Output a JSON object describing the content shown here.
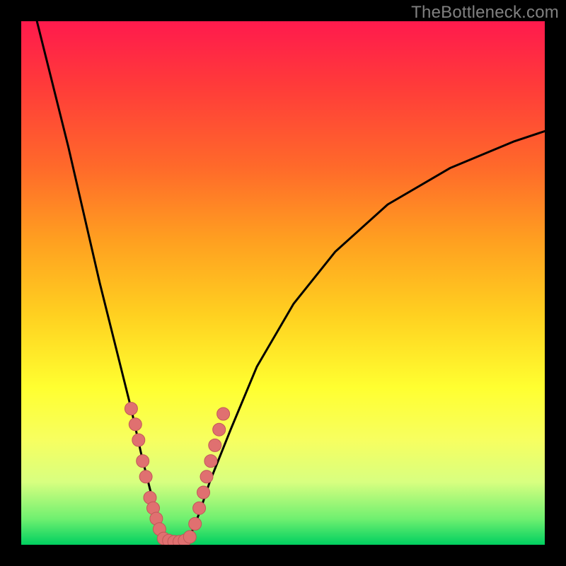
{
  "watermark": "TheBottleneck.com",
  "colors": {
    "frame": "#000000",
    "curve": "#000000",
    "marker_fill": "#e07070",
    "marker_stroke": "#c05858",
    "gradient_top": "#ff1a4d",
    "gradient_bottom": "#00d060"
  },
  "chart_data": {
    "type": "line",
    "title": "",
    "xlabel": "",
    "ylabel": "",
    "xlim": [
      0,
      100
    ],
    "ylim": [
      0,
      100
    ],
    "note": "Axes unlabeled; values are read as percentages of the plotting area width (x) and height from bottom (y). Bottleneck-style V-curve with minimum near x≈27.",
    "series": [
      {
        "name": "left-branch",
        "x": [
          3,
          6,
          9,
          12,
          15,
          18,
          21,
          23,
          25,
          26,
          27
        ],
        "y": [
          100,
          88,
          76,
          63,
          50,
          38,
          26,
          17,
          9,
          4,
          1
        ]
      },
      {
        "name": "valley",
        "x": [
          27,
          28,
          30,
          32
        ],
        "y": [
          1,
          0.5,
          0.5,
          1
        ]
      },
      {
        "name": "right-branch",
        "x": [
          32,
          34,
          36,
          40,
          45,
          52,
          60,
          70,
          82,
          94,
          100
        ],
        "y": [
          1,
          6,
          12,
          22,
          34,
          46,
          56,
          65,
          72,
          77,
          79
        ]
      }
    ],
    "markers": {
      "name": "highlighted-points",
      "note": "Salmon dots clustered on both sides of the valley and along its floor.",
      "points": [
        {
          "x": 21.0,
          "y": 26
        },
        {
          "x": 21.8,
          "y": 23
        },
        {
          "x": 22.4,
          "y": 20
        },
        {
          "x": 23.2,
          "y": 16
        },
        {
          "x": 23.8,
          "y": 13
        },
        {
          "x": 24.6,
          "y": 9
        },
        {
          "x": 25.2,
          "y": 7
        },
        {
          "x": 25.8,
          "y": 5
        },
        {
          "x": 26.4,
          "y": 3
        },
        {
          "x": 27.2,
          "y": 1.2
        },
        {
          "x": 28.2,
          "y": 0.8
        },
        {
          "x": 29.2,
          "y": 0.6
        },
        {
          "x": 30.2,
          "y": 0.6
        },
        {
          "x": 31.2,
          "y": 0.8
        },
        {
          "x": 32.2,
          "y": 1.5
        },
        {
          "x": 33.2,
          "y": 4
        },
        {
          "x": 34.0,
          "y": 7
        },
        {
          "x": 34.8,
          "y": 10
        },
        {
          "x": 35.4,
          "y": 13
        },
        {
          "x": 36.2,
          "y": 16
        },
        {
          "x": 37.0,
          "y": 19
        },
        {
          "x": 37.8,
          "y": 22
        },
        {
          "x": 38.6,
          "y": 25
        }
      ]
    }
  }
}
